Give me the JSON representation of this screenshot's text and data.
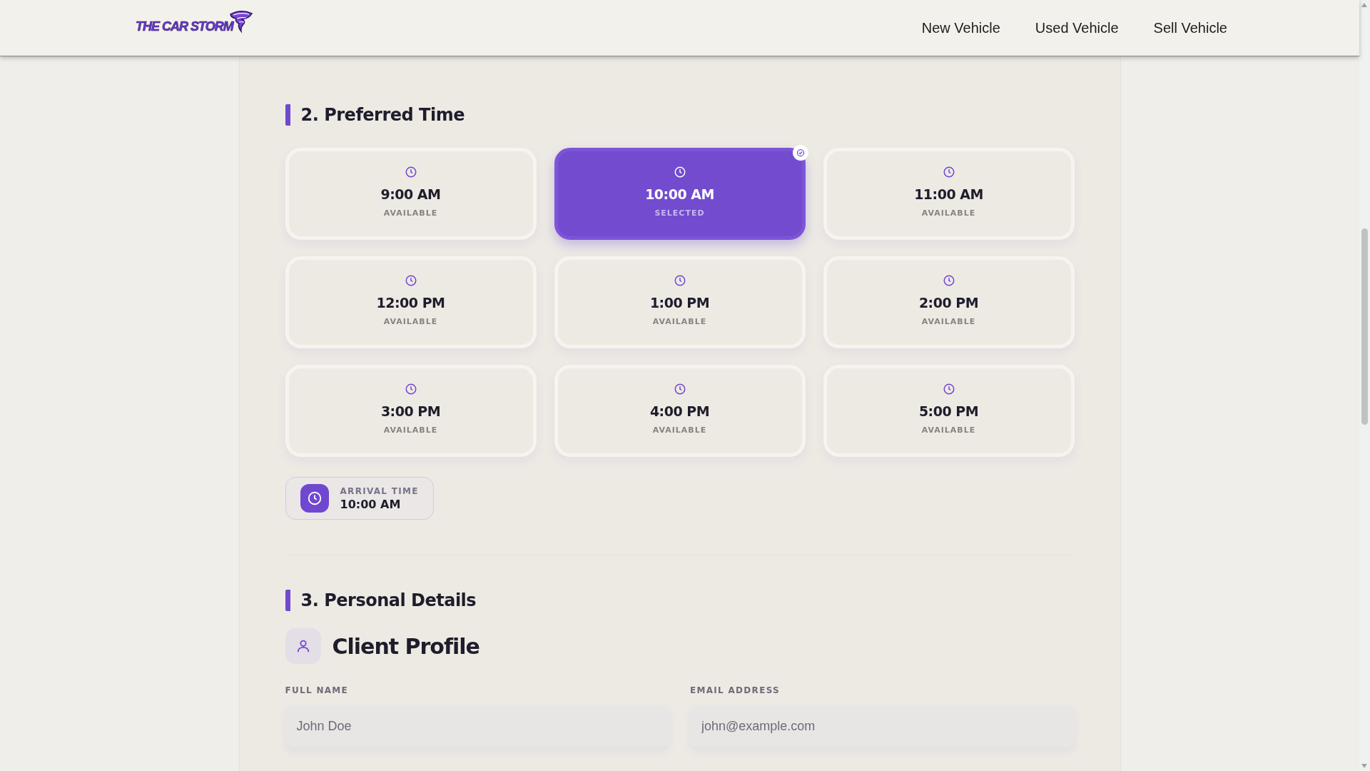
{
  "header": {
    "logo": "THE CAR STORM",
    "nav": [
      {
        "label": "New Vehicle"
      },
      {
        "label": "Used Vehicle"
      },
      {
        "label": "Sell Vehicle"
      }
    ]
  },
  "time_section": {
    "title": "2. Preferred Time",
    "slots": [
      {
        "time": "9:00 AM",
        "status": "AVAILABLE",
        "selected": false
      },
      {
        "time": "10:00 AM",
        "status": "SELECTED",
        "selected": true
      },
      {
        "time": "11:00 AM",
        "status": "AVAILABLE",
        "selected": false
      },
      {
        "time": "12:00 PM",
        "status": "AVAILABLE",
        "selected": false
      },
      {
        "time": "1:00 PM",
        "status": "AVAILABLE",
        "selected": false
      },
      {
        "time": "2:00 PM",
        "status": "AVAILABLE",
        "selected": false
      },
      {
        "time": "3:00 PM",
        "status": "AVAILABLE",
        "selected": false
      },
      {
        "time": "4:00 PM",
        "status": "AVAILABLE",
        "selected": false
      },
      {
        "time": "5:00 PM",
        "status": "AVAILABLE",
        "selected": false
      }
    ],
    "arrival": {
      "label": "ARRIVAL TIME",
      "value": "10:00 AM"
    }
  },
  "personal_section": {
    "title": "3. Personal Details",
    "profile_title": "Client Profile",
    "fields": [
      {
        "label": "FULL NAME",
        "placeholder": "John Doe"
      },
      {
        "label": "EMAIL ADDRESS",
        "placeholder": "john@example.com"
      }
    ]
  }
}
